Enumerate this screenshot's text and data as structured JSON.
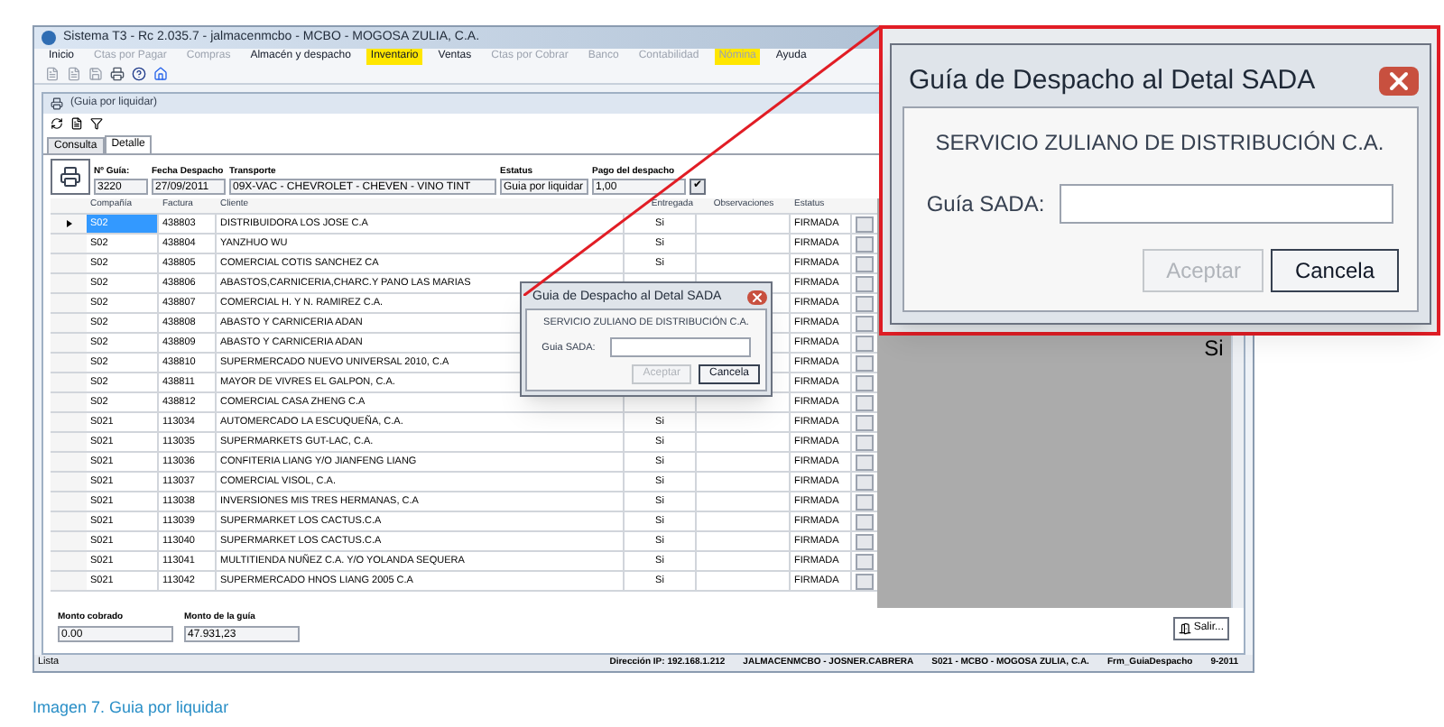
{
  "window": {
    "title": "Sistema T3 - Rc 2.035.7 - jalmacenmcbo - MCBO - MOGOSA ZULIA, C.A."
  },
  "menu": [
    {
      "label": "Inicio",
      "disabled": false,
      "highlighted": false
    },
    {
      "label": "Ctas por Pagar",
      "disabled": true,
      "highlighted": false
    },
    {
      "label": "Compras",
      "disabled": true,
      "highlighted": false
    },
    {
      "label": "Almacén y despacho",
      "disabled": false,
      "highlighted": false
    },
    {
      "label": "Inventario",
      "disabled": false,
      "highlighted": true
    },
    {
      "label": "Ventas",
      "disabled": false,
      "highlighted": false
    },
    {
      "label": "Ctas por Cobrar",
      "disabled": true,
      "highlighted": false
    },
    {
      "label": "Banco",
      "disabled": true,
      "highlighted": false
    },
    {
      "label": "Contabilidad",
      "disabled": true,
      "highlighted": false
    },
    {
      "label": "Nómina",
      "disabled": true,
      "highlighted": true
    },
    {
      "label": "Ayuda",
      "disabled": false,
      "highlighted": false
    }
  ],
  "child_window": {
    "title": "(Guia por liquidar)"
  },
  "tabs": [
    {
      "label": "Consulta",
      "selected": false
    },
    {
      "label": "Detalle",
      "selected": true
    }
  ],
  "header_fields": [
    {
      "label": "Nº Guía:",
      "value": "3220"
    },
    {
      "label": "Fecha Despacho",
      "value": "27/09/2011"
    },
    {
      "label": "Transporte",
      "value": "09X-VAC - CHEVROLET - CHEVEN - VINO TINT"
    },
    {
      "label": "Estatus",
      "value": "Guia por liquidar"
    },
    {
      "label": "Pago del despacho",
      "value": "1,00"
    }
  ],
  "table": {
    "columns": [
      "Compañía",
      "Factura",
      "Cliente",
      "Entregada",
      "Observaciones",
      "Estatus"
    ],
    "rows": [
      {
        "selected": true,
        "company": "S02",
        "invoice": "438803",
        "client": "DISTRIBUIDORA LOS JOSE C.A",
        "delivered": "Si",
        "status": "FIRMADA"
      },
      {
        "selected": false,
        "company": "S02",
        "invoice": "438804",
        "client": "YANZHUO WU",
        "delivered": "Si",
        "status": "FIRMADA"
      },
      {
        "selected": false,
        "company": "S02",
        "invoice": "438805",
        "client": "COMERCIAL COTIS SANCHEZ CA",
        "delivered": "Si",
        "status": "FIRMADA"
      },
      {
        "selected": false,
        "company": "S02",
        "invoice": "438806",
        "client": "ABASTOS,CARNICERIA,CHARC.Y PANO LAS MARIAS",
        "status": "FIRMADA"
      },
      {
        "selected": false,
        "company": "S02",
        "invoice": "438807",
        "client": "COMERCIAL H. Y N. RAMIREZ C.A.",
        "status": "FIRMADA"
      },
      {
        "selected": false,
        "company": "S02",
        "invoice": "438808",
        "client": "ABASTO Y CARNICERIA ADAN",
        "status": "FIRMADA"
      },
      {
        "selected": false,
        "company": "S02",
        "invoice": "438809",
        "client": "ABASTO Y CARNICERIA ADAN",
        "status": "FIRMADA"
      },
      {
        "selected": false,
        "company": "S02",
        "invoice": "438810",
        "client": "SUPERMERCADO NUEVO UNIVERSAL 2010, C.A",
        "status": "FIRMADA"
      },
      {
        "selected": false,
        "company": "S02",
        "invoice": "438811",
        "client": "MAYOR DE VIVRES EL GALPON, C.A.",
        "status": "FIRMADA"
      },
      {
        "selected": false,
        "company": "S02",
        "invoice": "438812",
        "client": "COMERCIAL CASA ZHENG C.A",
        "status": "FIRMADA"
      },
      {
        "selected": false,
        "company": "S021",
        "invoice": "113034",
        "client": "AUTOMERCADO LA ESCUQUEÑA, C.A.",
        "delivered": "Si",
        "status": "FIRMADA"
      },
      {
        "selected": false,
        "company": "S021",
        "invoice": "113035",
        "client": "SUPERMARKETS GUT-LAC, C.A.",
        "delivered": "Si",
        "status": "FIRMADA"
      },
      {
        "selected": false,
        "company": "S021",
        "invoice": "113036",
        "client": "CONFITERIA LIANG Y/O JIANFENG LIANG",
        "delivered": "Si",
        "status": "FIRMADA"
      },
      {
        "selected": false,
        "company": "S021",
        "invoice": "113037",
        "client": "COMERCIAL VISOL, C.A.",
        "delivered": "Si",
        "status": "FIRMADA"
      },
      {
        "selected": false,
        "company": "S021",
        "invoice": "113038",
        "client": "INVERSIONES MIS TRES HERMANAS, C.A",
        "delivered": "Si",
        "status": "FIRMADA"
      },
      {
        "selected": false,
        "company": "S021",
        "invoice": "113039",
        "client": "SUPERMARKET LOS CACTUS.C.A",
        "delivered": "Si",
        "status": "FIRMADA"
      },
      {
        "selected": false,
        "company": "S021",
        "invoice": "113040",
        "client": "SUPERMARKET LOS CACTUS.C.A",
        "delivered": "Si",
        "status": "FIRMADA"
      },
      {
        "selected": false,
        "company": "S021",
        "invoice": "113041",
        "client": "MULTITIENDA NUÑEZ C.A. Y/O YOLANDA SEQUERA",
        "delivered": "Si",
        "status": "FIRMADA"
      },
      {
        "selected": false,
        "company": "S021",
        "invoice": "113042",
        "client": "SUPERMERCADO HNOS LIANG 2005 C.A",
        "delivered": "Si",
        "status": "FIRMADA"
      }
    ]
  },
  "apply_button": "✔",
  "totals": [
    {
      "label": "Monto cobrado",
      "value": "0.00"
    },
    {
      "label": "Monto de la guía",
      "value": "47.931,23"
    }
  ],
  "exit_button": "Salir...",
  "status_bar": [
    "Lista",
    "Dirección IP: 192.168.1.212",
    "JALMACENMCBO - JOSNER.CABRERA",
    "S021 - MCBO - MOGOSA ZULIA, C.A.",
    "Frm_GuiaDespacho",
    "9-2011"
  ],
  "dialog": {
    "title": "Guia de Despacho al Detal SADA",
    "company": "SERVICIO ZULIANO DE DISTRIBUCIÓN C.A.",
    "field_label": "Guia SADA:",
    "buttons": [
      {
        "label": "Aceptar",
        "disabled": true
      },
      {
        "label": "Cancela",
        "disabled": false
      }
    ]
  },
  "callout": {
    "title": "Guía de Despacho al Detal SADA",
    "company": "SERVICIO ZULIANO DE DISTRIBUCIÓN C.A.",
    "field_label": "Guía SADA:",
    "buttons": [
      {
        "label": "Aceptar",
        "disabled": true
      },
      {
        "label": "Cancela",
        "disabled": false
      }
    ],
    "cell": "Si"
  },
  "caption": "Imagen 7. Guia por liquidar"
}
